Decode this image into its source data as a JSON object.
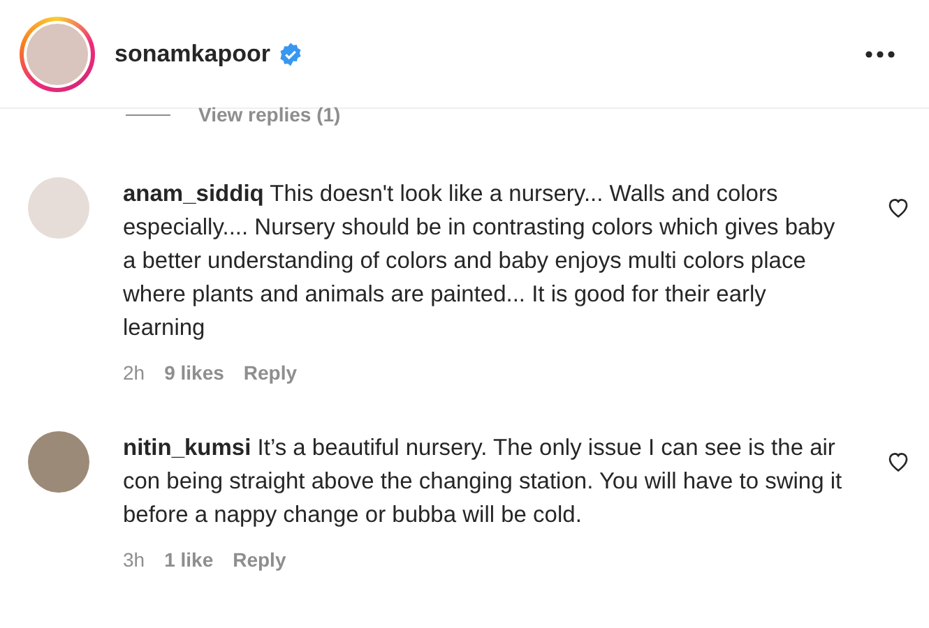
{
  "header": {
    "username": "sonamkapoor",
    "verified": true
  },
  "view_replies": "View replies (1)",
  "comments": [
    {
      "username": "anam_siddiq",
      "text": "This doesn't look like a nursery... Walls and colors especially.... Nursery should be in contrasting colors which gives baby a better understanding of colors and baby enjoys multi colors place where plants and animals are painted... It is good for their early learning",
      "time": "2h",
      "likes": "9 likes",
      "reply": "Reply",
      "liked": false
    },
    {
      "username": "nitin_kumsi",
      "text": "It’s a beautiful nursery. The only issue I can see is the air con being straight above the changing station. You will have to swing it before a nappy change or bubba will be cold.",
      "time": "3h",
      "likes": "1 like",
      "reply": "Reply",
      "liked": false
    }
  ]
}
